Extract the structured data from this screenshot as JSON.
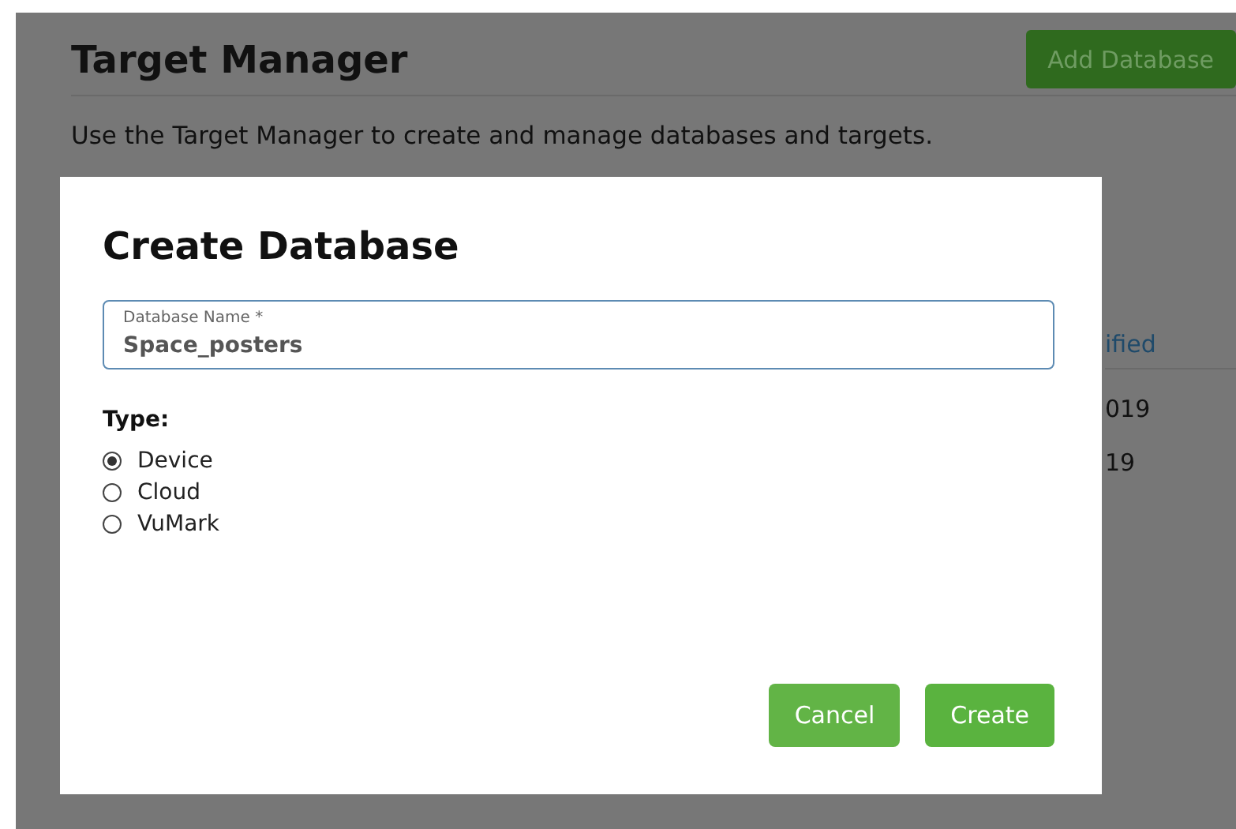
{
  "page": {
    "title": "Target Manager",
    "add_button": "Add Database",
    "description": "Use the Target Manager to create and manage databases and targets.",
    "table": {
      "column_header": "ified",
      "cells": [
        "019",
        "19"
      ]
    }
  },
  "dialog": {
    "title": "Create Database",
    "field": {
      "label": "Database Name *",
      "value": "Space_posters"
    },
    "type_label": "Type:",
    "options": [
      {
        "label": "Device",
        "selected": true
      },
      {
        "label": "Cloud",
        "selected": false
      },
      {
        "label": "VuMark",
        "selected": false
      }
    ],
    "buttons": [
      {
        "label": "Cancel",
        "kind": "secondary"
      },
      {
        "label": "Create",
        "kind": "primary"
      }
    ]
  }
}
